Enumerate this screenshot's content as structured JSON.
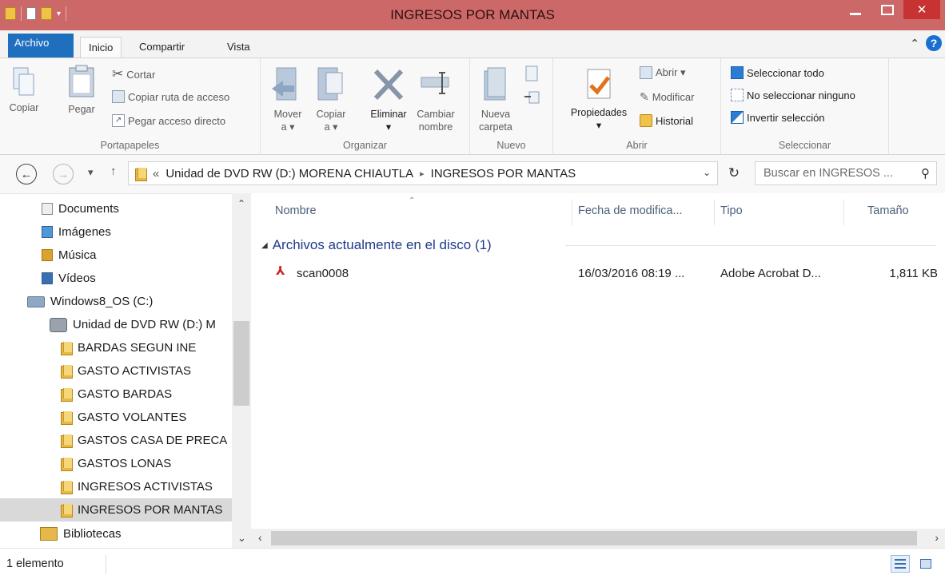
{
  "window": {
    "title": "INGRESOS POR MANTAS"
  },
  "tabs": {
    "archivo": "Archivo",
    "inicio": "Inicio",
    "compartir": "Compartir",
    "vista": "Vista"
  },
  "ribbon": {
    "portapapeles": {
      "copiar": "Copiar",
      "pegar": "Pegar",
      "cortar": "Cortar",
      "copiar_ruta": "Copiar ruta de acceso",
      "pegar_acceso": "Pegar acceso directo",
      "label": "Portapapeles"
    },
    "organizar": {
      "mover1": "Mover",
      "mover2": "a ▾",
      "copiar1": "Copiar",
      "copiar2": "a ▾",
      "eliminar": "Eliminar",
      "eliminar2": "▾",
      "cambiar1": "Cambiar",
      "cambiar2": "nombre",
      "label": "Organizar"
    },
    "nuevo": {
      "nueva1": "Nueva",
      "nueva2": "carpeta",
      "label": "Nuevo"
    },
    "abrir": {
      "propiedades": "Propiedades",
      "propiedades2": "▾",
      "abrir": "Abrir ▾",
      "modificar": "Modificar",
      "historial": "Historial",
      "label": "Abrir"
    },
    "seleccionar": {
      "todo": "Seleccionar todo",
      "ninguno": "No seleccionar ninguno",
      "invertir": "Invertir selección",
      "label": "Seleccionar"
    }
  },
  "address": {
    "prefix": "«",
    "seg1": "Unidad de DVD RW (D:) MORENA CHIAUTLA",
    "sep": "▸",
    "seg2": "INGRESOS POR MANTAS",
    "dropdown": "⌄"
  },
  "search": {
    "placeholder": "Buscar en INGRESOS ..."
  },
  "nav": {
    "items": [
      {
        "label": "Documents"
      },
      {
        "label": "Imágenes"
      },
      {
        "label": "Música"
      },
      {
        "label": "Vídeos"
      },
      {
        "label": "Windows8_OS (C:)"
      },
      {
        "label": "Unidad de DVD RW (D:) M"
      },
      {
        "label": "BARDAS SEGUN INE"
      },
      {
        "label": "GASTO ACTIVISTAS"
      },
      {
        "label": "GASTO BARDAS"
      },
      {
        "label": "GASTO VOLANTES"
      },
      {
        "label": "GASTOS CASA DE PRECA"
      },
      {
        "label": "GASTOS LONAS"
      },
      {
        "label": "INGRESOS ACTIVISTAS"
      },
      {
        "label": "INGRESOS POR MANTAS"
      },
      {
        "label": "Bibliotecas"
      }
    ]
  },
  "columns": {
    "nombre": "Nombre",
    "fecha": "Fecha de modifica...",
    "tipo": "Tipo",
    "tamano": "Tamaño"
  },
  "group": {
    "title": "Archivos actualmente en el disco (1)"
  },
  "files": [
    {
      "name": "scan0008",
      "date": "16/03/2016 08:19 ...",
      "type": "Adobe Acrobat D...",
      "size": "1,811 KB"
    }
  ],
  "status": {
    "count": "1 elemento"
  }
}
